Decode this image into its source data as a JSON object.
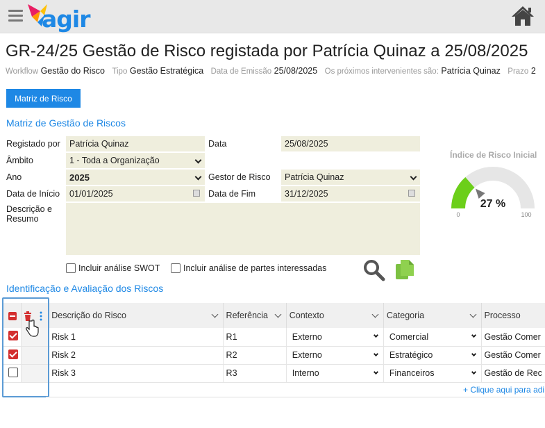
{
  "header": {
    "logo_text": "agir",
    "accent": "#1e88e5"
  },
  "page": {
    "title": "GR-24/25 Gestão de Risco registada por Patrícia Quinaz a 25/08/2025",
    "meta": {
      "workflow_label": "Workflow",
      "workflow_value": "Gestão do Risco",
      "tipo_label": "Tipo",
      "tipo_value": "Gestão Estratégica",
      "emissao_label": "Data de Emissão",
      "emissao_value": "25/08/2025",
      "intervenientes_label": "Os próximos intervenientes são:",
      "intervenientes_value": "Patrícia Quinaz",
      "prazo_label": "Prazo",
      "prazo_value": "2"
    },
    "matriz_button": "Matriz de Risco"
  },
  "form": {
    "section_title": "Matriz de Gestão de Riscos",
    "registado_por_label": "Registado por",
    "registado_por_value": "Patrícia Quinaz",
    "data_label": "Data",
    "data_value": "25/08/2025",
    "ambito_label": "Âmbito",
    "ambito_value": "1 - Toda a Organização",
    "ano_label": "Ano",
    "ano_value": "2025",
    "gestor_label": "Gestor de Risco",
    "gestor_value": "Patrícia Quinaz",
    "data_inicio_label": "Data de Início",
    "data_inicio_value": "01/01/2025",
    "data_fim_label": "Data de Fim",
    "data_fim_value": "31/12/2025",
    "descricao_label_1": "Descrição e",
    "descricao_label_2": "Resumo",
    "swot_label": "Incluir análise SWOT",
    "partes_label": "Incluir análise de partes interessadas"
  },
  "gauge": {
    "title": "Índice de Risco Inicial",
    "value_label": "27 %",
    "value": 27,
    "min": "0",
    "max": "100",
    "color": "#6ccf1a"
  },
  "risks": {
    "section_title": "Identificação e Avaliação dos Riscos",
    "columns": [
      "Descrição do Risco",
      "Referência",
      "Contexto",
      "Categoria",
      "Processo"
    ],
    "rows": [
      {
        "checked": true,
        "descricao": "Risk 1",
        "referencia": "R1",
        "contexto": "Externo",
        "categoria": "Comercial",
        "processo": "Gestão Comer"
      },
      {
        "checked": true,
        "descricao": "Risk 2",
        "referencia": "R2",
        "contexto": "Externo",
        "categoria": "Estratégico",
        "processo": "Gestão Comer"
      },
      {
        "checked": false,
        "descricao": "Risk 3",
        "referencia": "R3",
        "contexto": "Interno",
        "categoria": "Financeiros",
        "processo": "Gestão de Rec"
      }
    ],
    "add_link": "+ Clique aqui para adi"
  }
}
